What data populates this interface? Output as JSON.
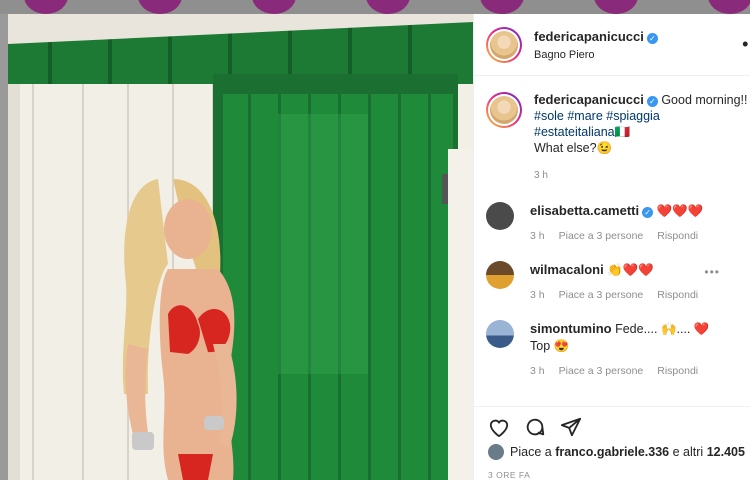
{
  "post": {
    "author": "federicapanicucci",
    "location": "Bagno Piero",
    "caption_text": "Good morning!!",
    "hashtags_line1": "#sole #mare #spiaggia",
    "hashtags_line2": "#estateitaliana",
    "flag": "🇮🇹",
    "caption_tail": "What else?😉",
    "caption_time": "3 h",
    "liked_by": "franco.gabriele.336",
    "likes_prefix": "Piace a",
    "likes_mid": "e altri",
    "likes_count": "12.405",
    "posted_ago": "3 ORE FA"
  },
  "comments": [
    {
      "user": "elisabetta.cametti",
      "verified": true,
      "text": "❤️❤️❤️",
      "time": "3 h",
      "likes": "Piace a 3 persone",
      "reply": "Rispondi",
      "avatar_color": "#4a4a4a"
    },
    {
      "user": "wilmacaloni",
      "verified": false,
      "text": "👏❤️❤️",
      "time": "3 h",
      "likes": "Piace a 3 persone",
      "reply": "Rispondi",
      "avatar_color": "#c08a2a"
    },
    {
      "user": "simontumino",
      "verified": false,
      "text_line1": "Fede.... 🙌.... ❤️",
      "text_line2": "Top 😍",
      "time": "3 h",
      "likes": "Piace a 3 persone",
      "reply": "Rispondi",
      "avatar_color": "#5a7da8"
    }
  ],
  "colors": {
    "door_green": "#1f8a3a",
    "wall_white": "#f4f1ea",
    "accent_blue": "#3897f0"
  },
  "icons": [
    "heart-icon",
    "comment-icon",
    "share-icon",
    "bookmark-icon",
    "more-icon",
    "verified-icon"
  ]
}
